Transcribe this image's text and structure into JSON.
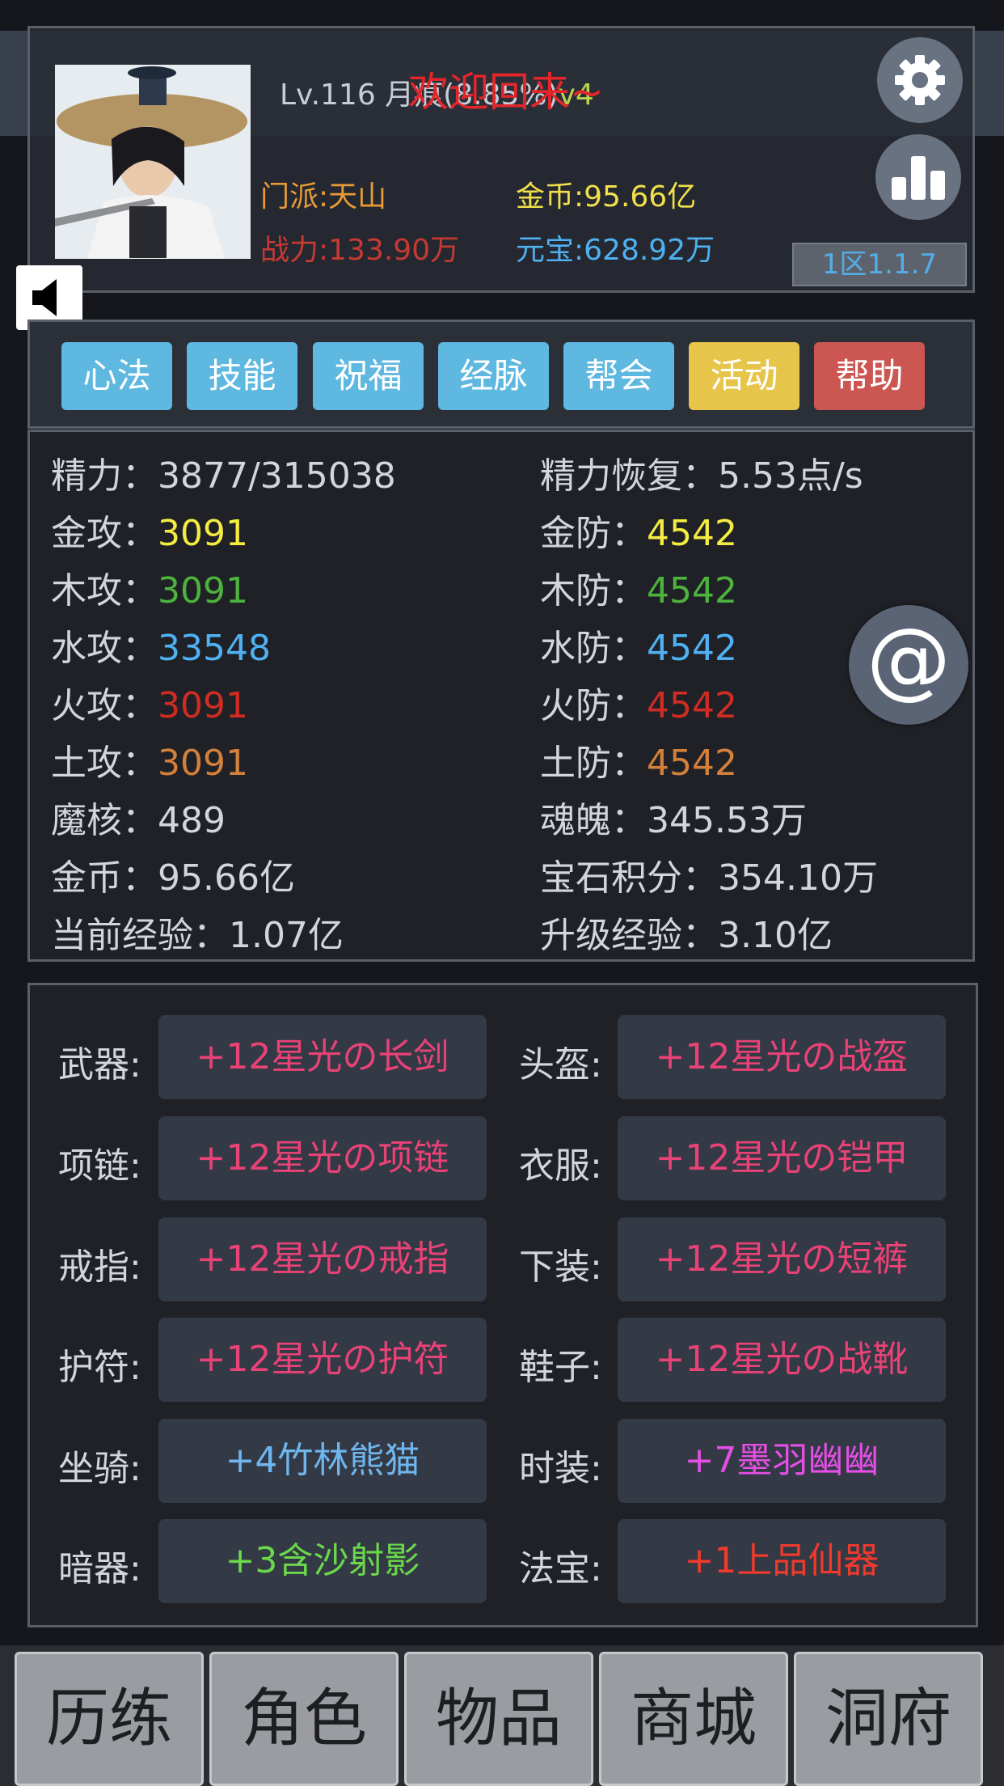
{
  "header": {
    "level_text": "Lv.116 月痕(8.85%)",
    "vip": "v4",
    "welcome": "欢迎回来~",
    "sect": "门派:天山",
    "power": "战力:133.90万",
    "gold": "金币:95.66亿",
    "yuanbao": "元宝:628.92万",
    "server": "1区1.1.7"
  },
  "tabs": [
    {
      "label": "心法",
      "color": "#5fb8df"
    },
    {
      "label": "技能",
      "color": "#5fb8df"
    },
    {
      "label": "祝福",
      "color": "#5fb8df"
    },
    {
      "label": "经脉",
      "color": "#5fb8df"
    },
    {
      "label": "帮会",
      "color": "#5fb8df"
    },
    {
      "label": "活动",
      "color": "#e7c54a"
    },
    {
      "label": "帮助",
      "color": "#cc5652"
    }
  ],
  "stats": {
    "left": [
      {
        "label": "精力：",
        "value": "3877/315038",
        "color": "#d2d5db"
      },
      {
        "label": "金攻：",
        "value": "3091",
        "color": "#f4ec41"
      },
      {
        "label": "木攻：",
        "value": "3091",
        "color": "#4db33d"
      },
      {
        "label": "水攻：",
        "value": "33548",
        "color": "#4fb1f2"
      },
      {
        "label": "火攻：",
        "value": "3091",
        "color": "#cf2d24"
      },
      {
        "label": "土攻：",
        "value": "3091",
        "color": "#d2803a"
      },
      {
        "label": "魔核：",
        "value": "489",
        "color": "#d2d5db"
      },
      {
        "label": "金币：",
        "value": "95.66亿",
        "color": "#d2d5db"
      },
      {
        "label": "当前经验：",
        "value": "1.07亿",
        "color": "#d2d5db"
      }
    ],
    "right": [
      {
        "label": "精力恢复：",
        "value": "5.53点/s",
        "color": "#d2d5db"
      },
      {
        "label": "金防：",
        "value": "4542",
        "color": "#f4ec41"
      },
      {
        "label": "木防：",
        "value": "4542",
        "color": "#4db33d"
      },
      {
        "label": "水防：",
        "value": "4542",
        "color": "#4fb1f2"
      },
      {
        "label": "火防：",
        "value": "4542",
        "color": "#cf2d24"
      },
      {
        "label": "土防：",
        "value": "4542",
        "color": "#d2803a"
      },
      {
        "label": "魂魄：",
        "value": "345.53万",
        "color": "#d2d5db"
      },
      {
        "label": "宝石积分：",
        "value": "354.10万",
        "color": "#d2d5db"
      },
      {
        "label": "升级经验：",
        "value": "3.10亿",
        "color": "#d2d5db"
      }
    ]
  },
  "equipment": {
    "left": [
      {
        "label": "武器:",
        "item": "+12星光の长剑",
        "color": "#e84276"
      },
      {
        "label": "项链:",
        "item": "+12星光の项链",
        "color": "#e84276"
      },
      {
        "label": "戒指:",
        "item": "+12星光の戒指",
        "color": "#e84276"
      },
      {
        "label": "护符:",
        "item": "+12星光の护符",
        "color": "#e84276"
      },
      {
        "label": "坐骑:",
        "item": "+4竹林熊猫",
        "color": "#6fb6ee"
      },
      {
        "label": "暗器:",
        "item": "+3含沙射影",
        "color": "#69d84a"
      }
    ],
    "right": [
      {
        "label": "头盔:",
        "item": "+12星光の战盔",
        "color": "#e84276"
      },
      {
        "label": "衣服:",
        "item": "+12星光の铠甲",
        "color": "#e84276"
      },
      {
        "label": "下装:",
        "item": "+12星光の短裤",
        "color": "#e84276"
      },
      {
        "label": "鞋子:",
        "item": "+12星光の战靴",
        "color": "#e84276"
      },
      {
        "label": "时装:",
        "item": "+7墨羽幽幽",
        "color": "#e64fe6"
      },
      {
        "label": "法宝:",
        "item": "+1上品仙器",
        "color": "#ef3a2c"
      }
    ]
  },
  "nav": [
    "历练",
    "角色",
    "物品",
    "商城",
    "洞府"
  ]
}
